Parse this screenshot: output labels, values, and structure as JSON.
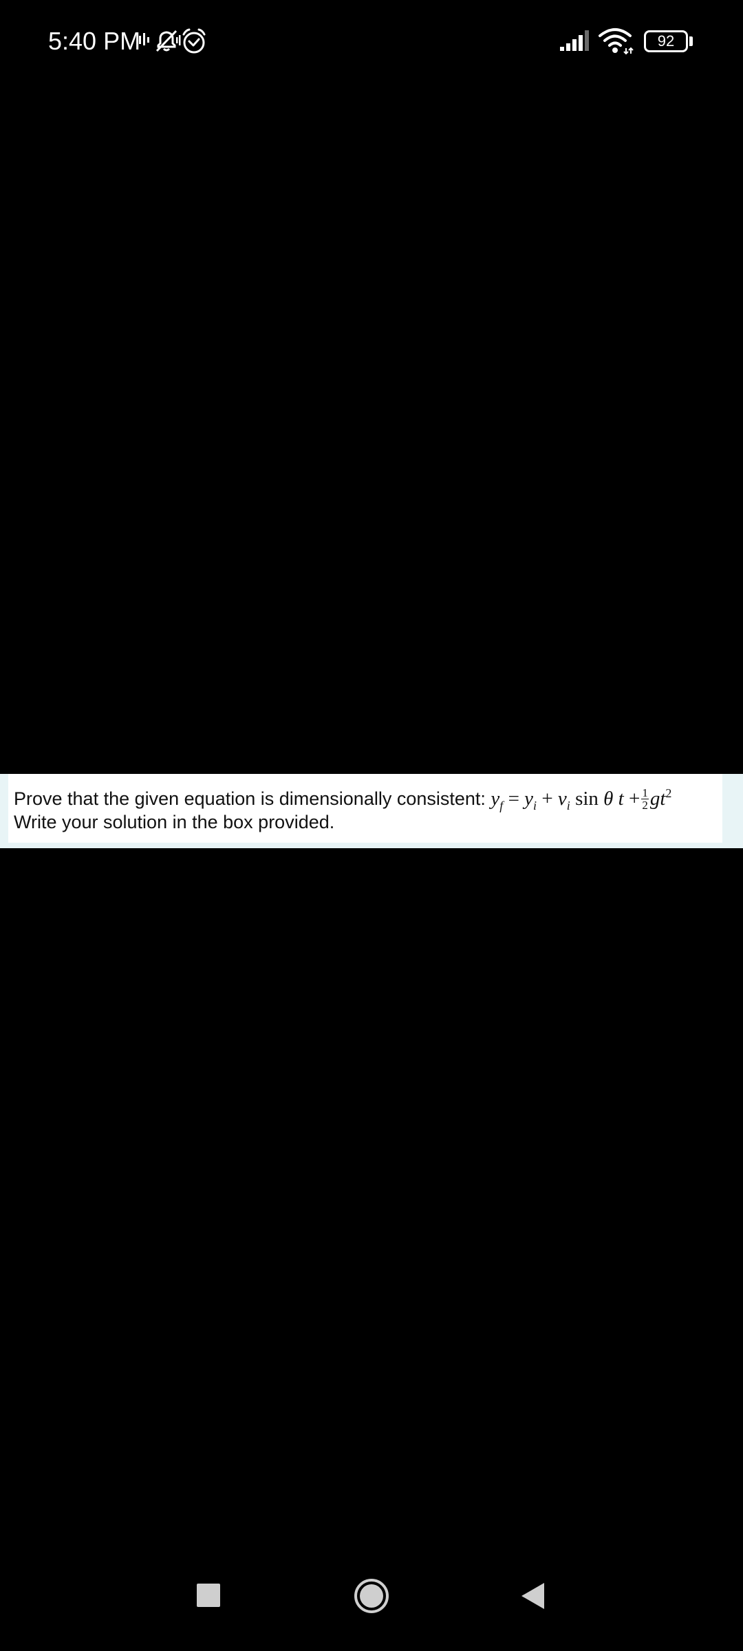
{
  "status_bar": {
    "time": "5:40 PM",
    "battery_level": "92",
    "icons": [
      "volte-icon",
      "mute-icon",
      "alarm-icon",
      "signal-icon",
      "wifi-icon",
      "battery-icon"
    ]
  },
  "question": {
    "prompt": "Prove that the given equation is dimensionally consistent:",
    "instruction": "Write your solution in the box provided.",
    "equation": {
      "lhs_var": "y",
      "lhs_sub": "f",
      "equals": "=",
      "term1_var": "y",
      "term1_sub": "i",
      "plus1": "+",
      "term2_var": "v",
      "term2_sub": "i",
      "sin": "sin",
      "theta": "θ",
      "t": "t",
      "plus2": "+",
      "frac_num": "1",
      "frac_den": "2",
      "g": "g",
      "t2": "t",
      "exp": "2"
    }
  },
  "nav_bar": {
    "buttons": [
      "recents-button",
      "home-button",
      "back-button"
    ]
  },
  "colors": {
    "background": "#000000",
    "question_band": "#e8f4f6",
    "question_box": "#ffffff",
    "text": "#111111",
    "nav_icon": "#cfcfcf"
  }
}
